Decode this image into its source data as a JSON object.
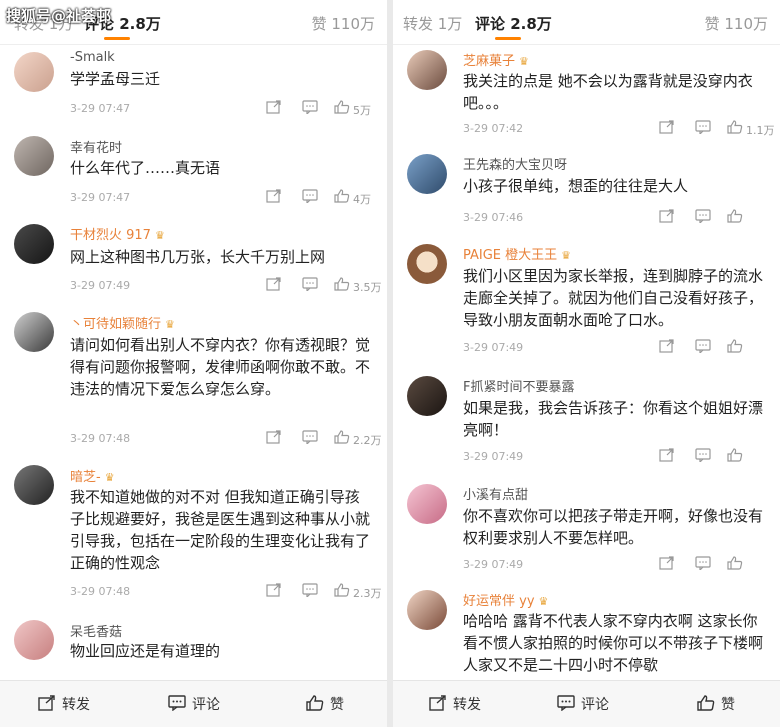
{
  "watermark": "搜狐号@祉荟邨",
  "left": {
    "tabs": {
      "repost": "转发 1万",
      "comment": "评论 2.8万",
      "likes": "赞 110万"
    },
    "comments": [
      {
        "name": "-Smalk",
        "name_style": "gray",
        "crown": false,
        "text": "学学孟母三迁",
        "time": "3-29 07:47",
        "likes": "5万"
      },
      {
        "name": "幸有花时",
        "name_style": "gray",
        "crown": false,
        "text": "什么年代了……真无语",
        "time": "3-29 07:47",
        "likes": "4万"
      },
      {
        "name": "干材烈火 917",
        "name_style": "orange",
        "crown": true,
        "text": "网上这种图书几万张，长大千万别上网",
        "time": "3-29 07:49",
        "likes": "3.5万"
      },
      {
        "name": "丶可待如颖随行",
        "name_style": "orange",
        "crown": true,
        "text": "请问如何看出别人不穿内衣？你有透视眼？觉得有问题你报警啊，发律师函啊你敢不敢。不违法的情况下爱怎么穿怎么穿。",
        "time": "3-29 07:48",
        "likes": "2.2万"
      },
      {
        "name": "暗芝-",
        "name_style": "orange",
        "crown": true,
        "text": "我不知道她做的对不对 但我知道正确引导孩子比规避要好，我爸是医生遇到这种事从小就引导我，包括在一定阶段的生理变化让我有了正确的性观念",
        "time": "3-29 07:48",
        "likes": "2.3万"
      },
      {
        "name": "呆毛香菇",
        "name_style": "gray",
        "crown": false,
        "text": "物业回应还是有道理的",
        "time": "",
        "likes": ""
      }
    ],
    "bottom": {
      "repost": "转发",
      "comment": "评论",
      "like": "赞"
    }
  },
  "right": {
    "tabs": {
      "repost": "转发 1万",
      "comment": "评论 2.8万",
      "likes": "赞 110万"
    },
    "comments": [
      {
        "name": "芝麻菓子",
        "name_style": "orange",
        "crown": true,
        "text": "我关注的点是 她不会以为露背就是没穿内衣吧。。。",
        "time": "3-29 07:42",
        "likes": "1.1万"
      },
      {
        "name": "王先森的大宝贝呀",
        "name_style": "gray",
        "crown": false,
        "text": "小孩子很单纯，想歪的往往是大人",
        "time": "3-29 07:46",
        "likes": ""
      },
      {
        "name": "PAIGE 橙大王王",
        "name_style": "orange",
        "crown": true,
        "text": "我们小区里因为家长举报，连到脚脖子的流水走廊全关掉了。就因为他们自己没看好孩子，导致小朋友面朝水面呛了口水。",
        "time": "3-29 07:49",
        "likes": ""
      },
      {
        "name": "F抓紧时间不要暴露",
        "name_style": "gray",
        "crown": false,
        "text": "如果是我，我会告诉孩子：你看这个姐姐好漂亮啊！",
        "time": "3-29 07:49",
        "likes": ""
      },
      {
        "name": "小溪有点甜",
        "name_style": "gray",
        "crown": false,
        "text": "你不喜欢你可以把孩子带走开啊，好像也没有权利要求别人不要怎样吧。",
        "time": "3-29 07:49",
        "likes": ""
      },
      {
        "name": "好运常伴 yy",
        "name_style": "orange",
        "crown": true,
        "text": "哈哈哈 露背不代表人家不穿内衣啊 这家长你看不惯人家拍照的时候你可以不带孩子下楼啊 人家又不是二十四小时不停歇",
        "time": "",
        "likes": ""
      }
    ],
    "bottom": {
      "repost": "转发",
      "comment": "评论",
      "like": "赞"
    }
  },
  "colors": {
    "accent": "#ff8200",
    "vip_name": "#e8823a",
    "meta": "#aaaaaa"
  },
  "icons": [
    "share-icon",
    "reply-icon",
    "thumb-up-icon",
    "repost-icon",
    "comment-icon",
    "crown-icon"
  ]
}
